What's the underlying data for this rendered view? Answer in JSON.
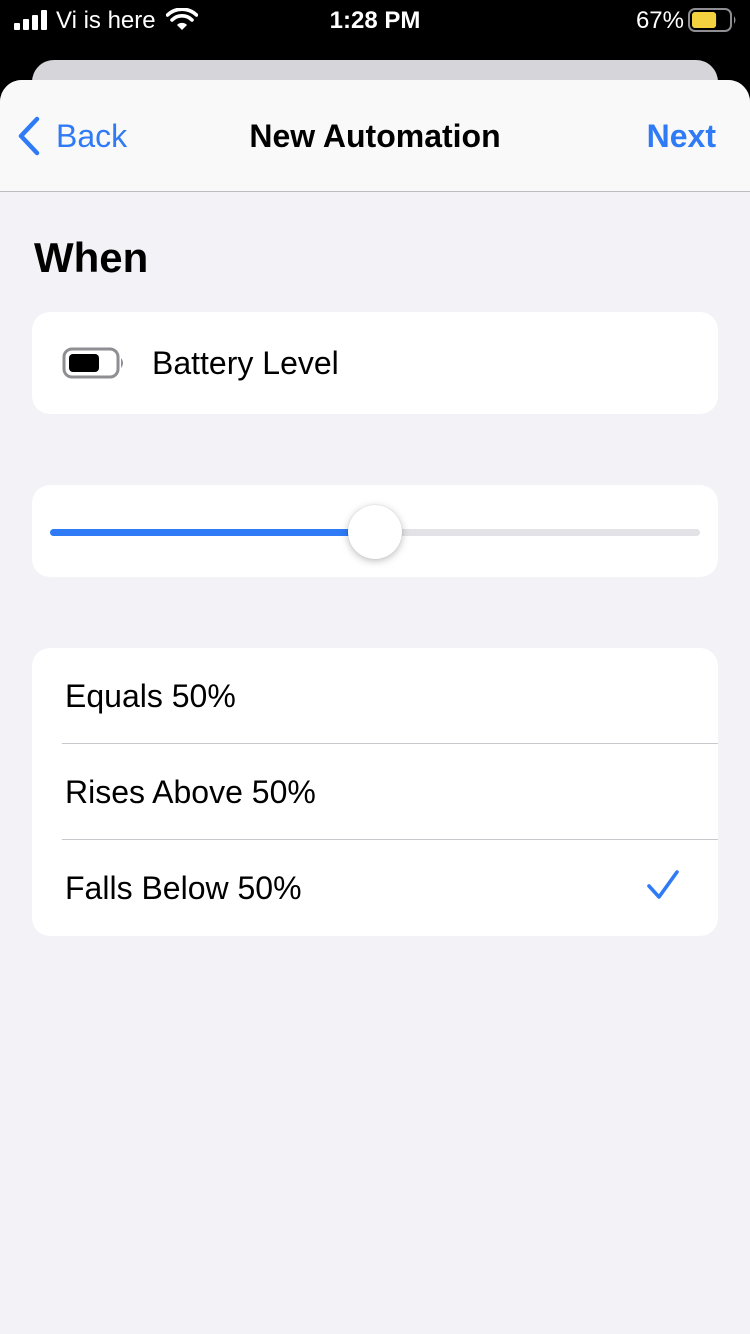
{
  "status_bar": {
    "carrier": "Vi is here",
    "time": "1:28 PM",
    "battery_percent": "67%",
    "battery_fill_fraction": 0.67,
    "battery_color": "#f4d23f",
    "icons": [
      "signal-icon",
      "wifi-icon",
      "battery-icon"
    ]
  },
  "nav": {
    "back_label": "Back",
    "title": "New Automation",
    "next_label": "Next",
    "accent_color": "#2f7bf5"
  },
  "section_title": "When",
  "trigger": {
    "icon": "battery-icon",
    "label": "Battery Level"
  },
  "slider": {
    "value_percent": 50
  },
  "options": [
    {
      "label": "Equals 50%",
      "selected": false
    },
    {
      "label": "Rises Above 50%",
      "selected": false
    },
    {
      "label": "Falls Below 50%",
      "selected": true
    }
  ]
}
